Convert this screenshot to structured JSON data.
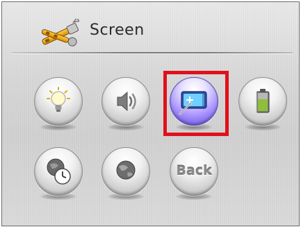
{
  "header": {
    "title": "Screen",
    "icon": "tools-icon"
  },
  "menu": {
    "row1": [
      {
        "name": "brightness",
        "icon": "lightbulb-icon"
      },
      {
        "name": "volume",
        "icon": "speaker-icon"
      },
      {
        "name": "calibrate",
        "icon": "touchscreen-calibrate-icon",
        "selected": true
      },
      {
        "name": "battery",
        "icon": "battery-icon"
      }
    ],
    "row2": [
      {
        "name": "time",
        "icon": "globe-clock-icon"
      },
      {
        "name": "language",
        "icon": "globe-icon"
      },
      {
        "name": "back",
        "label": "Back"
      }
    ]
  },
  "colors": {
    "selection": "#e0101a",
    "accent": "#7a5cff"
  }
}
